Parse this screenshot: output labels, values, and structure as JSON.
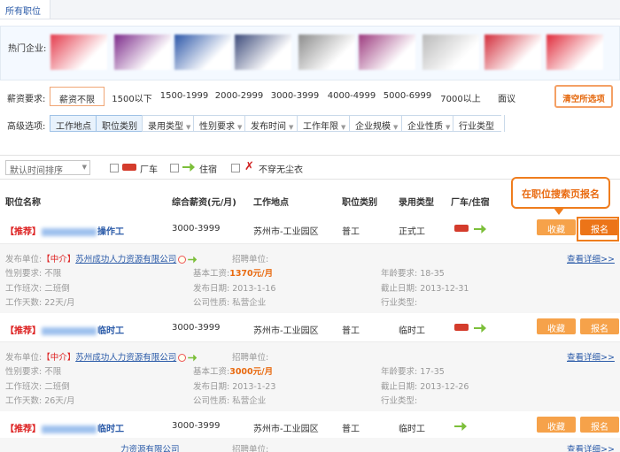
{
  "breadcrumb": {
    "label": "所有职位"
  },
  "companies": {
    "label": "热门企业:",
    "logos": [
      {
        "name": "company-logo-1",
        "color": "#e43b4c"
      },
      {
        "name": "company-logo-2",
        "color": "#7c2a8a"
      },
      {
        "name": "company-logo-3",
        "color": "#2b56a8"
      },
      {
        "name": "company-logo-4",
        "color": "#3c4a7a"
      },
      {
        "name": "company-logo-5",
        "color": "#8c8c8c"
      },
      {
        "name": "company-logo-6",
        "color": "#9c3a7e"
      },
      {
        "name": "company-logo-7",
        "color": "#b9b9b9"
      },
      {
        "name": "company-logo-8",
        "color": "#d22c3a"
      },
      {
        "name": "company-logo-9",
        "color": "#e02a3a"
      }
    ]
  },
  "salary": {
    "label": "薪资要求:",
    "options": [
      "薪资不限",
      "1500以下",
      "1500-1999",
      "2000-2999",
      "3000-3999",
      "4000-4999",
      "5000-6999",
      "7000以上",
      "面议"
    ],
    "clear_label": "清空所选项"
  },
  "advanced": {
    "label": "高级选项:",
    "filters": [
      "工作地点",
      "职位类别",
      "录用类型",
      "性别要求",
      "发布时间",
      "工作年限",
      "企业规模",
      "企业性质",
      "行业类型"
    ]
  },
  "sortbar": {
    "sort_value": "默认时间排序",
    "checks": [
      "厂车",
      "住宿",
      "不穿无尘衣"
    ]
  },
  "table": {
    "headers": [
      "职位名称",
      "综合薪资(元/月)",
      "工作地点",
      "职位类别",
      "录用类型",
      "厂车/住宿"
    ],
    "collect_label": "收藏",
    "apply_label": "报名"
  },
  "callout": "在职位搜索页报名",
  "jobs": [
    {
      "tag": "【推荐】",
      "title": "操作工",
      "salary": "3000-3999",
      "location": "苏州市-工业园区",
      "category": "普工",
      "type": "正式工",
      "publisher_label": "发布单位:",
      "agency": "【中介】",
      "company": "苏州成功人力资源有限公司",
      "recruiter_label": "招聘单位:",
      "gender": "性别要求: 不限",
      "base_wage_label": "基本工资:",
      "base_wage": "1370元/月",
      "age": "年龄要求: 18-35",
      "shift": "工作班次: 二班倒",
      "pub_date": "发布日期: 2013-1-16",
      "end_date": "截止日期: 2013-12-31",
      "days": "工作天数: 22天/月",
      "company_type": "公司性质: 私营企业",
      "industry": "行业类型:",
      "more": "查看详细>>"
    },
    {
      "tag": "【推荐】",
      "title": "临时工",
      "salary": "3000-3999",
      "location": "苏州市-工业园区",
      "category": "普工",
      "type": "临时工",
      "publisher_label": "发布单位:",
      "agency": "【中介】",
      "company": "苏州成功人力资源有限公司",
      "recruiter_label": "招聘单位:",
      "gender": "性别要求: 不限",
      "base_wage_label": "基本工资:",
      "base_wage": "3000元/月",
      "age": "年龄要求: 17-35",
      "shift": "工作班次: 二班倒",
      "pub_date": "发布日期: 2013-1-23",
      "end_date": "截止日期: 2013-12-26",
      "days": "工作天数: 26天/月",
      "company_type": "公司性质: 私营企业",
      "industry": "行业类型:",
      "more": "查看详细>>"
    },
    {
      "tag": "【推荐】",
      "title": "临时工",
      "salary": "3000-3999",
      "location": "苏州市-工业园区",
      "category": "普工",
      "type": "临时工",
      "partial_company": "力资源有限公司",
      "partial_recruiter": "招聘单位:",
      "partial_more": "查看详细>>"
    }
  ]
}
